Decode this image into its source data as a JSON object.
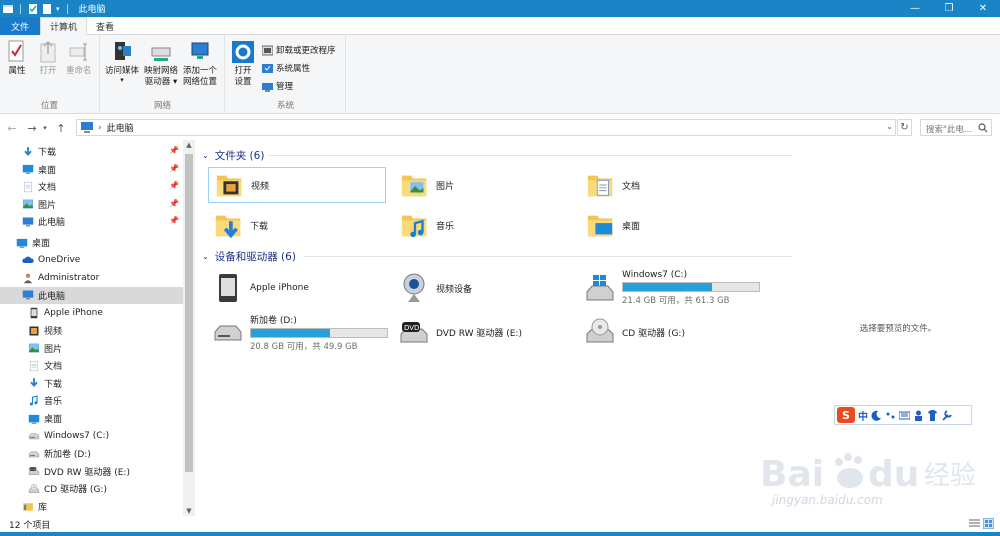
{
  "window": {
    "title": "此电脑"
  },
  "colors": {
    "titlebar": "#1b84c6",
    "file_tab": "#1979ca",
    "accent": "#26a0da",
    "section_header": "#1e3287",
    "selection": "#d9d9d9"
  },
  "tabs": [
    {
      "label": "文件"
    },
    {
      "label": "计算机"
    },
    {
      "label": "查看"
    }
  ],
  "ribbon": {
    "location": {
      "label": "位置",
      "properties": "属性",
      "open": "打开",
      "rename": "重命名"
    },
    "network": {
      "label": "网络",
      "media_1": "访问媒体",
      "map_drive_1": "映射网络",
      "map_drive_2": "驱动器",
      "add_loc_1": "添加一个",
      "add_loc_2": "网络位置"
    },
    "system": {
      "label": "系统",
      "settings_1": "打开",
      "settings_2": "设置",
      "uninstall": "卸载或更改程序",
      "sys_props": "系统属性",
      "manage": "管理"
    }
  },
  "address": {
    "path": "此电脑",
    "search_placeholder": "搜索\"此电..."
  },
  "nav": {
    "quick_access": [
      {
        "label": "下载",
        "icon": "download-arrow-icon"
      },
      {
        "label": "桌面",
        "icon": "desktop-icon"
      },
      {
        "label": "文档",
        "icon": "documents-icon"
      },
      {
        "label": "图片",
        "icon": "pictures-icon"
      },
      {
        "label": "此电脑",
        "icon": "computer-icon"
      }
    ],
    "tree": [
      {
        "label": "桌面",
        "icon": "desktop-icon",
        "indent": 0
      },
      {
        "label": "OneDrive",
        "icon": "onedrive-cloud-icon",
        "indent": 1
      },
      {
        "label": "Administrator",
        "icon": "user-icon",
        "indent": 1
      },
      {
        "label": "此电脑",
        "icon": "computer-icon",
        "indent": 1,
        "selected": true
      },
      {
        "label": "Apple iPhone",
        "icon": "phone-icon",
        "indent": 2
      },
      {
        "label": "视频",
        "icon": "videos-icon",
        "indent": 2
      },
      {
        "label": "图片",
        "icon": "pictures-icon",
        "indent": 2
      },
      {
        "label": "文档",
        "icon": "documents-icon",
        "indent": 2
      },
      {
        "label": "下载",
        "icon": "download-arrow-icon",
        "indent": 2
      },
      {
        "label": "音乐",
        "icon": "music-note-icon",
        "indent": 2
      },
      {
        "label": "桌面",
        "icon": "desktop-icon",
        "indent": 2
      },
      {
        "label": "Windows7 (C:)",
        "icon": "drive-icon",
        "indent": 2
      },
      {
        "label": "新加卷 (D:)",
        "icon": "drive-icon",
        "indent": 2
      },
      {
        "label": "DVD RW 驱动器 (E:)",
        "icon": "dvd-drive-icon",
        "indent": 2
      },
      {
        "label": "CD 驱动器 (G:)",
        "icon": "cd-drive-icon",
        "indent": 2
      },
      {
        "label": "库",
        "icon": "library-icon",
        "indent": 1
      }
    ]
  },
  "folders": {
    "header": "文件夹 (6)",
    "items": [
      {
        "label": "视频",
        "icon": "videos-folder-icon"
      },
      {
        "label": "图片",
        "icon": "pictures-folder-icon"
      },
      {
        "label": "文档",
        "icon": "documents-folder-icon"
      },
      {
        "label": "下载",
        "icon": "downloads-folder-icon"
      },
      {
        "label": "音乐",
        "icon": "music-folder-icon"
      },
      {
        "label": "桌面",
        "icon": "desktop-folder-icon"
      }
    ]
  },
  "devices": {
    "header": "设备和驱动器 (6)",
    "items": [
      {
        "label": "Apple iPhone",
        "icon": "phone-icon"
      },
      {
        "label": "视频设备",
        "icon": "webcam-icon"
      },
      {
        "label": "Windows7 (C:)",
        "icon": "windows-drive-icon",
        "free_text": "21.4 GB 可用，共 61.3 GB",
        "used_fraction": 0.651
      },
      {
        "label": "新加卷 (D:)",
        "icon": "drive-icon",
        "free_text": "20.8 GB 可用，共 49.9 GB",
        "used_fraction": 0.583
      },
      {
        "label": "DVD RW 驱动器 (E:)",
        "icon": "dvd-drive-icon"
      },
      {
        "label": "CD 驱动器 (G:)",
        "icon": "cd-drive-icon"
      }
    ]
  },
  "preview": {
    "text": "选择要预览的文件。"
  },
  "ime": {
    "logo": "S",
    "mode": "中"
  },
  "watermark": {
    "brand": "Bai",
    "brand2": "du",
    "cn": "经验",
    "url": "jingyan.baidu.com"
  },
  "status": {
    "count": "12 个项目"
  }
}
